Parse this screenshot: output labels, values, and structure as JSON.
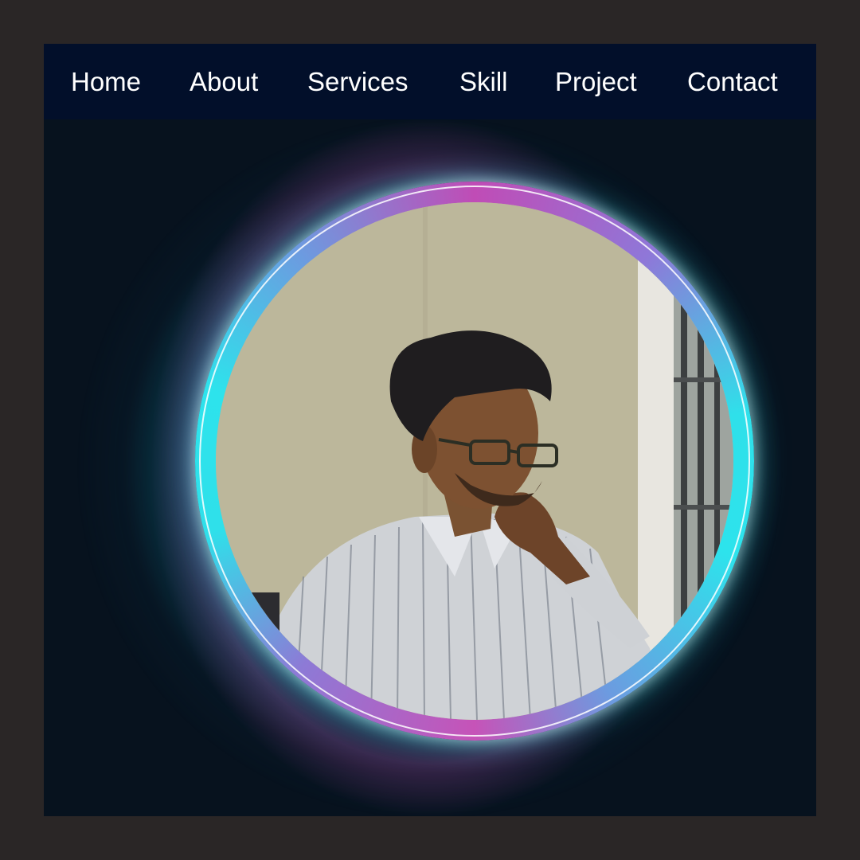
{
  "nav": {
    "items": [
      {
        "label": "Home"
      },
      {
        "label": "About"
      },
      {
        "label": "Services"
      },
      {
        "label": "Skill"
      },
      {
        "label": "Project"
      },
      {
        "label": "Contact"
      }
    ]
  },
  "hero": {
    "photo": "profile-photo",
    "ring_colors": [
      "#2de3ec",
      "#c04cb6",
      "#ffffff"
    ]
  },
  "colors": {
    "page_bg": "#2a2626",
    "navbar_bg": "#020f2a",
    "hero_bg": "#07121e",
    "glow": "#14d2d7"
  }
}
